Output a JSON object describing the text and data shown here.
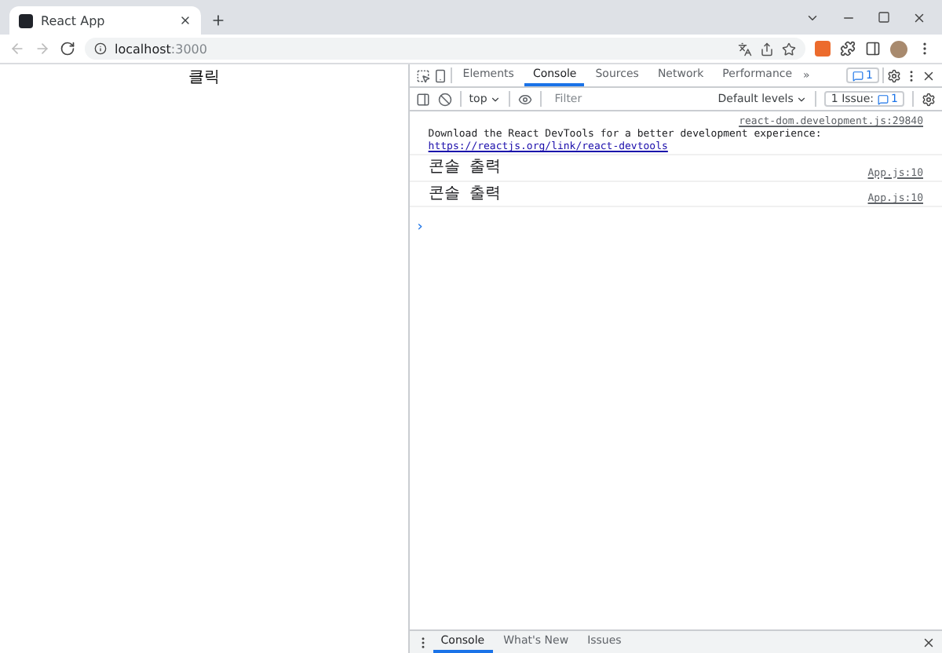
{
  "browser": {
    "tab_title": "React App",
    "url_host": "localhost",
    "url_port": ":3000"
  },
  "page": {
    "button_label": "클릭"
  },
  "devtools": {
    "tabs": [
      {
        "label": "Elements",
        "selected": false
      },
      {
        "label": "Console",
        "selected": true
      },
      {
        "label": "Sources",
        "selected": false
      },
      {
        "label": "Network",
        "selected": false
      },
      {
        "label": "Performance",
        "selected": false
      }
    ],
    "more": "»",
    "message_badge": "1",
    "console_toolbar": {
      "context": "top",
      "filter_placeholder": "Filter",
      "levels": "Default levels",
      "issues_label": "1 Issue:",
      "issues_count": "1"
    },
    "messages": [
      {
        "source": "react-dom.development.js:29840",
        "text": "Download the React DevTools for a better development experience: ",
        "link": "https://reactjs.org/link/react-devtools"
      },
      {
        "source": "App.js:10",
        "text": "콘솔 출력"
      },
      {
        "source": "App.js:10",
        "text": "콘솔 출력"
      }
    ],
    "prompt": "›",
    "drawer_tabs": [
      {
        "label": "Console",
        "selected": true
      },
      {
        "label": "What's New",
        "selected": false
      },
      {
        "label": "Issues",
        "selected": false
      }
    ]
  }
}
